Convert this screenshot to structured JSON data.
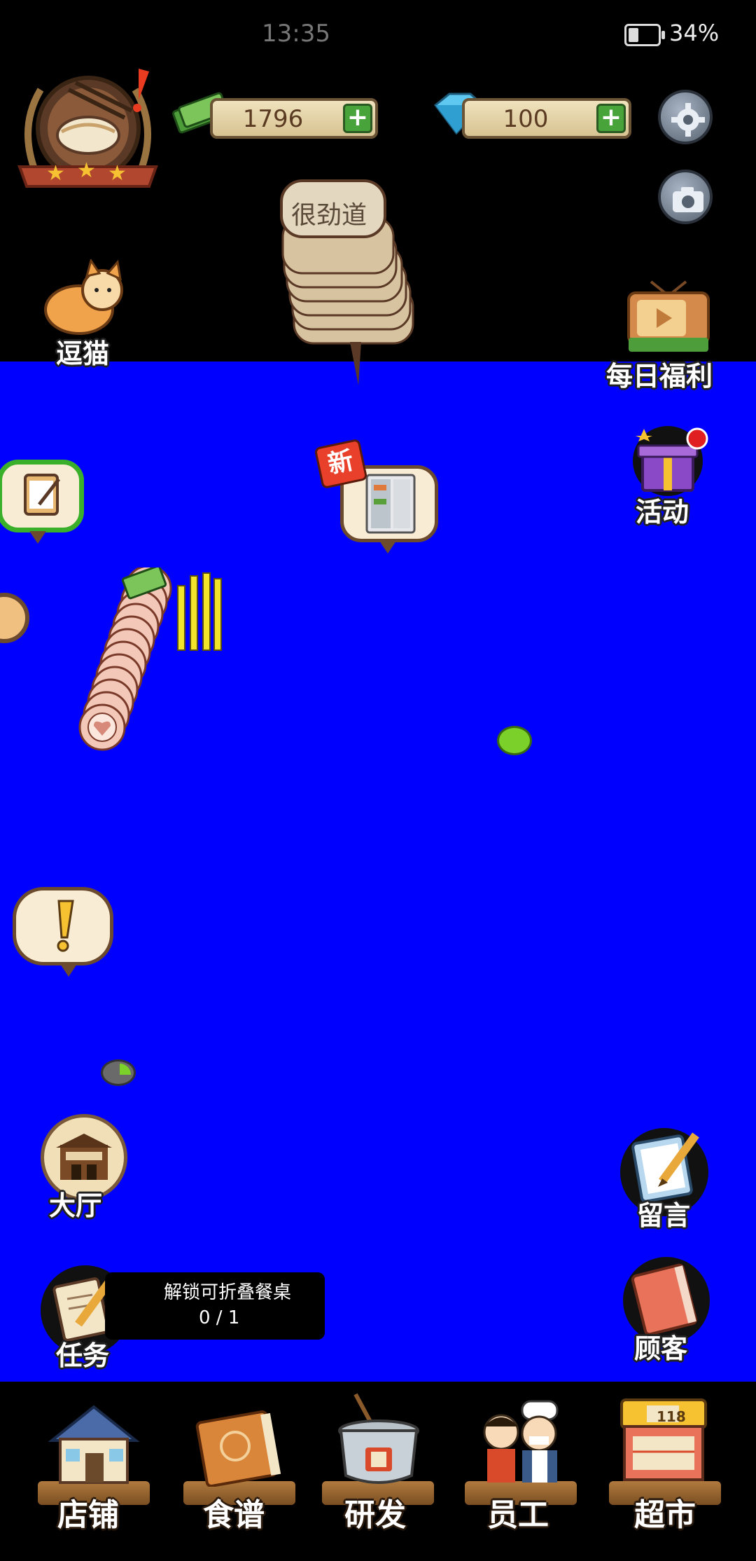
{
  "status_bar": {
    "time": "13:35",
    "battery": "34%"
  },
  "currency": {
    "cash": "1796",
    "gems": "100"
  },
  "chef_badge": {
    "stars": 3
  },
  "top_speech": "很劲道",
  "left_menu": {
    "cat": "逗猫",
    "hall": "大厅",
    "task": "任务"
  },
  "right_menu": {
    "daily": "每日福利",
    "events": "活动",
    "message": "留言",
    "customers": "顾客"
  },
  "new_badge": "新",
  "task_banner": {
    "title": "解锁可折叠餐桌",
    "progress": "0 / 1"
  },
  "bottom_nav": [
    {
      "label": "店铺"
    },
    {
      "label": "食谱"
    },
    {
      "label": "研发"
    },
    {
      "label": "员工"
    },
    {
      "label": "超市"
    }
  ],
  "colors": {
    "play_area": "#0000ff",
    "background": "#000000",
    "accent_green": "#47a33a"
  }
}
